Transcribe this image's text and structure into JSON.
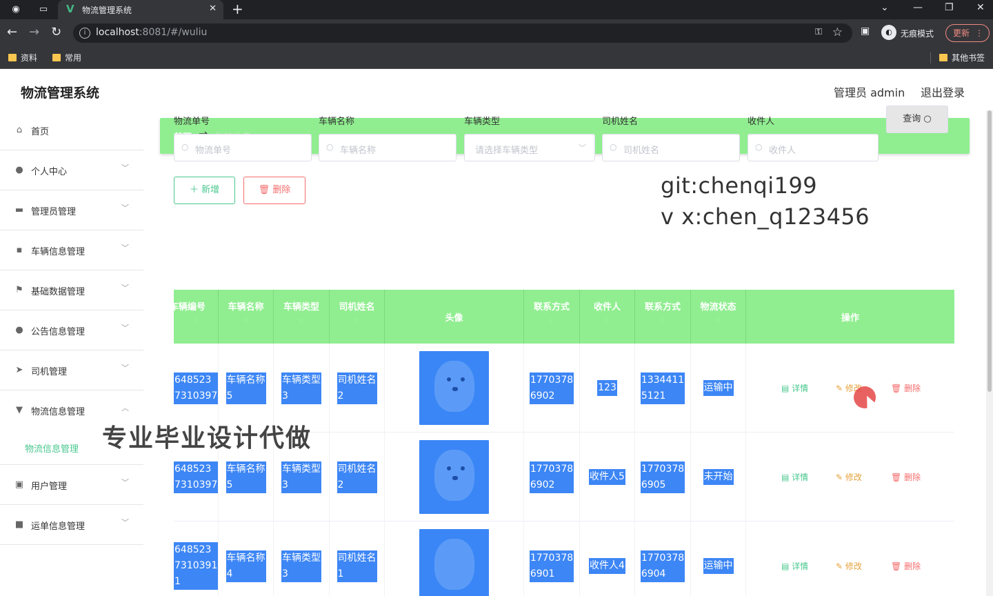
{
  "browser": {
    "tab_title": "物流管理系统",
    "url_host": "localhost",
    "url_rest": ":8081/#/wuliu",
    "incognito_label": "无痕模式",
    "update_label": "更新",
    "bookmarks": [
      "资料",
      "常用"
    ],
    "other_bookmarks": "其他书签"
  },
  "header": {
    "title": "物流管理系统",
    "admin": "管理员 admin",
    "logout": "退出登录"
  },
  "sidebar": {
    "items": [
      {
        "label": "首页",
        "icon": "home-icon"
      },
      {
        "label": "个人中心",
        "icon": "user-icon"
      },
      {
        "label": "管理员管理",
        "icon": "briefcase-icon"
      },
      {
        "label": "车辆信息管理",
        "icon": "chat-icon"
      },
      {
        "label": "基础数据管理",
        "icon": "flag-icon"
      },
      {
        "label": "公告信息管理",
        "icon": "bulb-icon"
      },
      {
        "label": "司机管理",
        "icon": "send-icon"
      },
      {
        "label": "物流信息管理",
        "icon": "tray-icon"
      },
      {
        "label": "用户管理",
        "icon": "picture-icon"
      },
      {
        "label": "运单信息管理",
        "icon": "camera-icon"
      }
    ],
    "submenu": "物流信息管理"
  },
  "breadcrumb": {
    "home": "首页",
    "arrow": "→",
    "current": "物流信息"
  },
  "filters": {
    "f1_label": "物流单号",
    "f1_ph": "物流单号",
    "f2_label": "车辆名称",
    "f2_ph": "车辆名称",
    "f3_label": "车辆类型",
    "f3_ph": "请选择车辆类型",
    "f4_label": "司机姓名",
    "f4_ph": "司机姓名",
    "f5_label": "收件人",
    "f5_ph": "收件人",
    "query": "查询"
  },
  "overlay": {
    "line1": "git:chenqi199",
    "line2": "v x:chen_q123456"
  },
  "buttons": {
    "add": "新增",
    "delete": "删除"
  },
  "table": {
    "headers": [
      "车辆编号",
      "车辆名称",
      "车辆类型",
      "司机姓名",
      "头像",
      "联系方式",
      "收件人",
      "联系方式",
      "物流状态",
      "操作"
    ],
    "sort_mark": "♢",
    "rows": [
      {
        "no": "648523\n7310397",
        "name": "车辆名称\n5",
        "type": "车辆类型\n3",
        "driver": "司机姓名\n2",
        "phone": "1770378\n6902",
        "receiver": "123",
        "rphone": "1334411\n5121",
        "status": "运输中"
      },
      {
        "no": "648523\n7310397",
        "name": "车辆名称\n5",
        "type": "车辆类型\n3",
        "driver": "司机姓名\n2",
        "phone": "1770378\n6902",
        "receiver": "收件人5",
        "rphone": "1770378\n6905",
        "status": "未开始"
      },
      {
        "no": "648523\n7310391\n1",
        "name": "车辆名称\n4",
        "type": "车辆类型\n3",
        "driver": "司机姓名\n1",
        "phone": "1770378\n6901",
        "receiver": "收件人4",
        "rphone": "1770378\n6904",
        "status": "运输中"
      }
    ],
    "actions": {
      "detail": "详情",
      "edit": "修改",
      "delete": "删除"
    }
  },
  "watermark": "专业毕业设计代做",
  "colors": {
    "header_green": "#90ee90",
    "accent": "#48c78e",
    "danger": "#f56c6c",
    "warning": "#e6a23c",
    "select_blue": "#3d86f5"
  }
}
